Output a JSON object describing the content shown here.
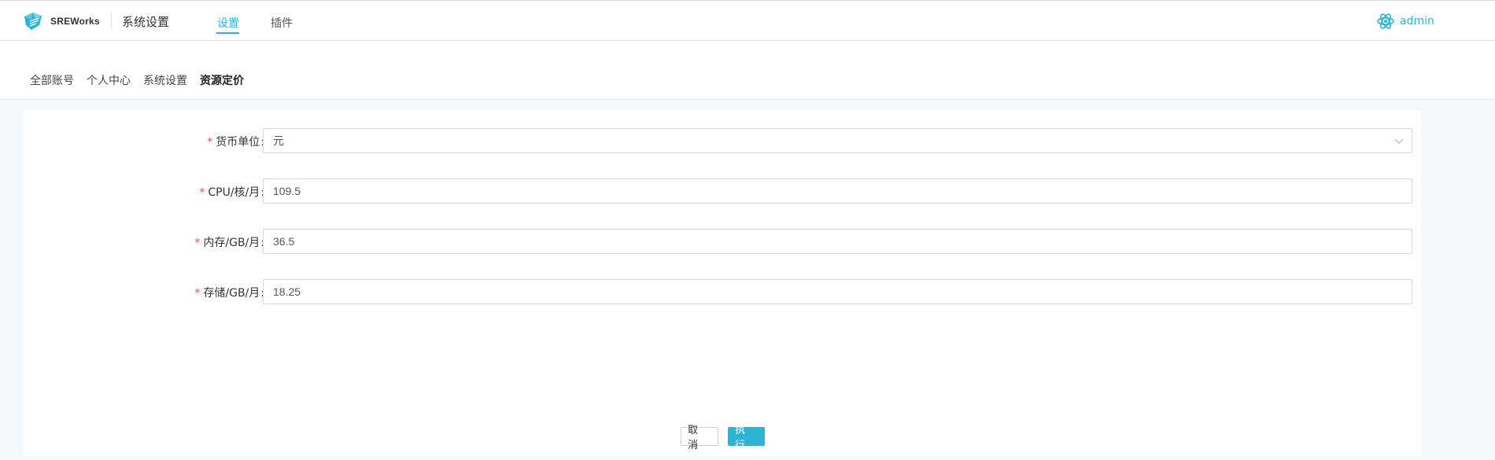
{
  "header": {
    "brand": "SREWorks",
    "app_title": "系统设置",
    "tabs": [
      {
        "label": "设置",
        "active": true
      },
      {
        "label": "插件",
        "active": false
      }
    ],
    "user": {
      "name": "admin",
      "icon": "atom-icon"
    },
    "accent_color": "#2bb5d4"
  },
  "subnav": {
    "items": [
      {
        "label": "全部账号",
        "active": false
      },
      {
        "label": "个人中心",
        "active": false
      },
      {
        "label": "系统设置",
        "active": false
      },
      {
        "label": "资源定价",
        "active": true
      }
    ]
  },
  "form": {
    "fields": [
      {
        "label": "货币单位",
        "required": true,
        "type": "select",
        "value": "元"
      },
      {
        "label": "CPU/核/月",
        "required": true,
        "type": "input",
        "value": "109.5"
      },
      {
        "label": "内存/GB/月",
        "required": true,
        "type": "input",
        "value": "36.5"
      },
      {
        "label": "存储/GB/月",
        "required": true,
        "type": "input",
        "value": "18.25"
      }
    ],
    "required_mark": "*",
    "colon": ":",
    "cancel_label": "取消",
    "submit_label": "执行"
  }
}
